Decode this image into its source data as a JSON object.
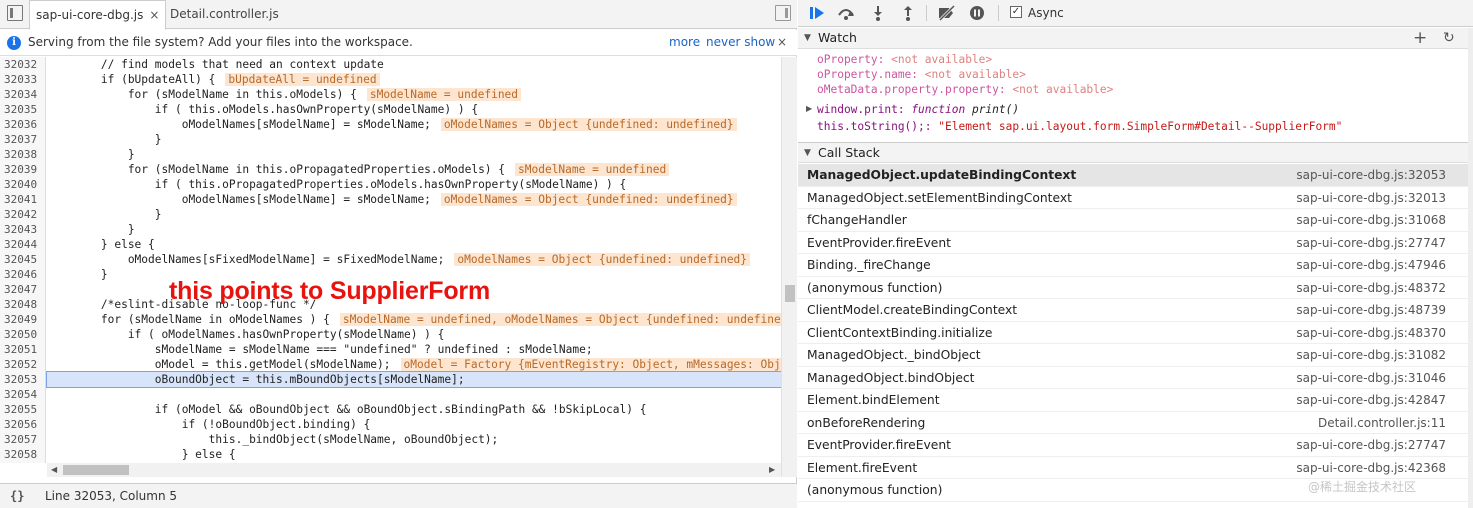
{
  "tabs": [
    {
      "label": "sap-ui-core-dbg.js",
      "close": "×"
    },
    {
      "label": "Detail.controller.js"
    }
  ],
  "infobar": {
    "icon": "i",
    "text": "Serving from the file system? Add your files into the workspace.",
    "more": "more",
    "never_show": "never show",
    "close": "×"
  },
  "code": {
    "lines": [
      {
        "n": "32032",
        "code": "        // find models that need an context update",
        "inline": ""
      },
      {
        "n": "32033",
        "code": "        if (bUpdateAll) {",
        "inline": "bUpdateAll = undefined"
      },
      {
        "n": "32034",
        "code": "            for (sModelName in this.oModels) {",
        "inline": "sModelName = undefined"
      },
      {
        "n": "32035",
        "code": "                if ( this.oModels.hasOwnProperty(sModelName) ) {",
        "inline": ""
      },
      {
        "n": "32036",
        "code": "                    oModelNames[sModelName] = sModelName;",
        "inline": "oModelNames = Object {undefined: undefined}"
      },
      {
        "n": "32037",
        "code": "                }",
        "inline": ""
      },
      {
        "n": "32038",
        "code": "            }",
        "inline": ""
      },
      {
        "n": "32039",
        "code": "            for (sModelName in this.oPropagatedProperties.oModels) {",
        "inline": "sModelName = undefined"
      },
      {
        "n": "32040",
        "code": "                if ( this.oPropagatedProperties.oModels.hasOwnProperty(sModelName) ) {",
        "inline": ""
      },
      {
        "n": "32041",
        "code": "                    oModelNames[sModelName] = sModelName;",
        "inline": "oModelNames = Object {undefined: undefined}"
      },
      {
        "n": "32042",
        "code": "                }",
        "inline": ""
      },
      {
        "n": "32043",
        "code": "            }",
        "inline": ""
      },
      {
        "n": "32044",
        "code": "        } else {",
        "inline": ""
      },
      {
        "n": "32045",
        "code": "            oModelNames[sFixedModelName] = sFixedModelName;",
        "inline": "oModelNames = Object {undefined: undefined}"
      },
      {
        "n": "32046",
        "code": "        }",
        "inline": ""
      },
      {
        "n": "32047",
        "code": "",
        "inline": ""
      },
      {
        "n": "32048",
        "code": "        /*eslint-disable no-loop-func */",
        "inline": ""
      },
      {
        "n": "32049",
        "code": "        for (sModelName in oModelNames ) {",
        "inline": "sModelName = undefined, oModelNames = Object {undefined: undefined}"
      },
      {
        "n": "32050",
        "code": "            if ( oModelNames.hasOwnProperty(sModelName) ) {",
        "inline": ""
      },
      {
        "n": "32051",
        "code": "                sModelName = sModelName === \"undefined\" ? undefined : sModelName;",
        "inline": ""
      },
      {
        "n": "32052",
        "code": "                oModel = this.getModel(sModelName);",
        "inline": "oModel = Factory {mEventRegistry: Object, mMessages: Object}"
      },
      {
        "n": "32053",
        "code": "                oBoundObject = this.mBoundObjects[sModelName];",
        "inline": ""
      },
      {
        "n": "32054",
        "code": "",
        "inline": ""
      },
      {
        "n": "32055",
        "code": "                if (oModel && oBoundObject && oBoundObject.sBindingPath && !bSkipLocal) {",
        "inline": ""
      },
      {
        "n": "32056",
        "code": "                    if (!oBoundObject.binding) {",
        "inline": ""
      },
      {
        "n": "32057",
        "code": "                        this._bindObject(sModelName, oBoundObject);",
        "inline": ""
      },
      {
        "n": "32058",
        "code": "                    } else {",
        "inline": ""
      },
      {
        "n": "32059",
        "code": "",
        "inline": ""
      }
    ],
    "highlighted_line": "32053"
  },
  "annotation": "this points to SupplierForm",
  "status": {
    "braces": "{}",
    "position": "Line 32053, Column 5"
  },
  "debugger": {
    "async_label": "Async",
    "async_checked": true
  },
  "watch": {
    "title": "Watch",
    "add": "+",
    "refresh": "↻",
    "items": [
      {
        "name": "oProperty:",
        "value": "<not available>"
      },
      {
        "name": "oProperty.name:",
        "value": "<not available>"
      },
      {
        "name": "oMetaData.property.property:",
        "value": "<not available>"
      }
    ],
    "print_name": "window.print:",
    "print_kw": "function",
    "print_val": "print()",
    "tostring_name": "this.toString();:",
    "tostring_val": "\"Element sap.ui.layout.form.SimpleForm#Detail--SupplierForm\""
  },
  "call_stack": {
    "title": "Call Stack",
    "frames": [
      {
        "name": "ManagedObject.updateBindingContext",
        "loc": "sap-ui-core-dbg.js:32053"
      },
      {
        "name": "ManagedObject.setElementBindingContext",
        "loc": "sap-ui-core-dbg.js:32013"
      },
      {
        "name": "fChangeHandler",
        "loc": "sap-ui-core-dbg.js:31068"
      },
      {
        "name": "EventProvider.fireEvent",
        "loc": "sap-ui-core-dbg.js:27747"
      },
      {
        "name": "Binding._fireChange",
        "loc": "sap-ui-core-dbg.js:47946"
      },
      {
        "name": "(anonymous function)",
        "loc": "sap-ui-core-dbg.js:48372"
      },
      {
        "name": "ClientModel.createBindingContext",
        "loc": "sap-ui-core-dbg.js:48739"
      },
      {
        "name": "ClientContextBinding.initialize",
        "loc": "sap-ui-core-dbg.js:48370"
      },
      {
        "name": "ManagedObject._bindObject",
        "loc": "sap-ui-core-dbg.js:31082"
      },
      {
        "name": "ManagedObject.bindObject",
        "loc": "sap-ui-core-dbg.js:31046"
      },
      {
        "name": "Element.bindElement",
        "loc": "sap-ui-core-dbg.js:42847"
      },
      {
        "name": "onBeforeRendering",
        "loc": "Detail.controller.js:11"
      },
      {
        "name": "EventProvider.fireEvent",
        "loc": "sap-ui-core-dbg.js:27747"
      },
      {
        "name": "Element.fireEvent",
        "loc": "sap-ui-core-dbg.js:42368"
      },
      {
        "name": "(anonymous function)",
        "loc": ""
      }
    ]
  },
  "watermark": "@稀土掘金技术社区"
}
